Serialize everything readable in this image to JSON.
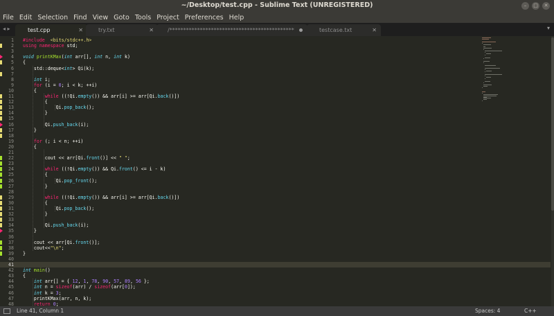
{
  "window": {
    "title": "~/Desktop/test.cpp - Sublime Text (UNREGISTERED)",
    "buttons": [
      "–",
      "□",
      "✕"
    ]
  },
  "menu": [
    "File",
    "Edit",
    "Selection",
    "Find",
    "View",
    "Goto",
    "Tools",
    "Project",
    "Preferences",
    "Help"
  ],
  "tab_nav": "◂ ▸",
  "tabs": [
    {
      "label": "test.cpp",
      "close": "✕",
      "active": true,
      "dirty": false
    },
    {
      "label": "try.txt",
      "close": "✕",
      "active": false,
      "dirty": false
    },
    {
      "label": "/*********************************************",
      "close": "",
      "active": false,
      "dirty": true
    },
    {
      "label": "testcase.txt",
      "close": "✕",
      "active": false,
      "dirty": false
    }
  ],
  "tab_overflow": "▾",
  "editor": {
    "current_line": 41,
    "lines": [
      [
        [
          "t-pre",
          "#include"
        ],
        [
          "",
          "  "
        ],
        [
          "t-str",
          "<bits/stdc++.h>"
        ]
      ],
      [
        [
          "t-kw",
          "using namespace"
        ],
        [
          "",
          " std;"
        ]
      ],
      [],
      [
        [
          "t-ty",
          "void"
        ],
        [
          "",
          " "
        ],
        [
          "t-cls",
          "printKMax"
        ],
        [
          "",
          "("
        ],
        [
          "t-ty",
          "int"
        ],
        [
          "",
          " arr[], "
        ],
        [
          "t-ty",
          "int"
        ],
        [
          "",
          " n, "
        ],
        [
          "t-ty",
          "int"
        ],
        [
          "",
          " k)"
        ]
      ],
      [
        [
          "",
          "{"
        ]
      ],
      [
        [
          "",
          "    std::deque<"
        ],
        [
          "t-ty",
          "int"
        ],
        [
          "",
          "> Qi(k);"
        ]
      ],
      [],
      [
        [
          "",
          "    "
        ],
        [
          "t-ty",
          "int"
        ],
        [
          "",
          " i;"
        ]
      ],
      [
        [
          "",
          "    "
        ],
        [
          "t-kw",
          "for"
        ],
        [
          "",
          " (i = "
        ],
        [
          "t-num",
          "0"
        ],
        [
          "",
          "; i < k; ++i)"
        ]
      ],
      [
        [
          "",
          "    {"
        ]
      ],
      [
        [
          "",
          "        "
        ],
        [
          "t-kw",
          "while"
        ],
        [
          "",
          " ((!Qi."
        ],
        [
          "t-fn",
          "empty"
        ],
        [
          "",
          "()) && arr[i] >= arr[Qi."
        ],
        [
          "t-fn",
          "back"
        ],
        [
          "",
          "()])"
        ]
      ],
      [
        [
          "",
          "        {"
        ]
      ],
      [
        [
          "",
          "            Qi."
        ],
        [
          "t-fn",
          "pop_back"
        ],
        [
          "",
          "();"
        ]
      ],
      [
        [
          "",
          "        }"
        ]
      ],
      [],
      [
        [
          "",
          "        Qi."
        ],
        [
          "t-fn",
          "push_back"
        ],
        [
          "",
          "(i);"
        ]
      ],
      [
        [
          "",
          "    }"
        ]
      ],
      [],
      [
        [
          "",
          "    "
        ],
        [
          "t-kw",
          "for"
        ],
        [
          "",
          " (; i < n; ++i)"
        ]
      ],
      [
        [
          "",
          "    {"
        ]
      ],
      [],
      [
        [
          "",
          "        cout << arr[Qi."
        ],
        [
          "t-fn",
          "front"
        ],
        [
          "",
          "()] << "
        ],
        [
          "t-str",
          "\" \""
        ],
        [
          "",
          ";"
        ]
      ],
      [],
      [
        [
          "",
          "        "
        ],
        [
          "t-kw",
          "while"
        ],
        [
          "",
          " ((!Qi."
        ],
        [
          "t-fn",
          "empty"
        ],
        [
          "",
          "()) && Qi."
        ],
        [
          "t-fn",
          "front"
        ],
        [
          "",
          "() <= i - k)"
        ]
      ],
      [
        [
          "",
          "        {"
        ]
      ],
      [
        [
          "",
          "            Qi."
        ],
        [
          "t-fn",
          "pop_front"
        ],
        [
          "",
          "();"
        ]
      ],
      [
        [
          "",
          "        }"
        ]
      ],
      [],
      [
        [
          "",
          "        "
        ],
        [
          "t-kw",
          "while"
        ],
        [
          "",
          " ((!Qi."
        ],
        [
          "t-fn",
          "empty"
        ],
        [
          "",
          "()) && arr[i] >= arr[Qi."
        ],
        [
          "t-fn",
          "back"
        ],
        [
          "",
          "()])"
        ]
      ],
      [
        [
          "",
          "        {"
        ]
      ],
      [
        [
          "",
          "            Qi."
        ],
        [
          "t-fn",
          "pop_back"
        ],
        [
          "",
          "();"
        ]
      ],
      [
        [
          "",
          "        }"
        ]
      ],
      [],
      [
        [
          "",
          "        Qi."
        ],
        [
          "t-fn",
          "push_back"
        ],
        [
          "",
          "(i);"
        ]
      ],
      [
        [
          "",
          "    }"
        ]
      ],
      [],
      [
        [
          "",
          "    cout << arr[Qi."
        ],
        [
          "t-fn",
          "front"
        ],
        [
          "",
          "()];"
        ]
      ],
      [
        [
          "",
          "    cout<<"
        ],
        [
          "t-str",
          "\"\\n\""
        ],
        [
          "",
          ";"
        ]
      ],
      [
        [
          "",
          "}"
        ]
      ],
      [],
      [],
      [
        [
          "t-ty",
          "int"
        ],
        [
          "",
          " "
        ],
        [
          "t-cls",
          "main"
        ],
        [
          "",
          "()"
        ]
      ],
      [
        [
          "",
          "{"
        ]
      ],
      [
        [
          "",
          "    "
        ],
        [
          "t-ty",
          "int"
        ],
        [
          "",
          " arr[] = { "
        ],
        [
          "t-num",
          "12"
        ],
        [
          "",
          ", "
        ],
        [
          "t-num",
          "1"
        ],
        [
          "",
          ", "
        ],
        [
          "t-num",
          "78"
        ],
        [
          "",
          ", "
        ],
        [
          "t-num",
          "90"
        ],
        [
          "",
          ", "
        ],
        [
          "t-num",
          "57"
        ],
        [
          "",
          ", "
        ],
        [
          "t-num",
          "89"
        ],
        [
          "",
          ", "
        ],
        [
          "t-num",
          "56"
        ],
        [
          "",
          " };"
        ]
      ],
      [
        [
          "",
          "    "
        ],
        [
          "t-ty",
          "int"
        ],
        [
          "",
          " n = "
        ],
        [
          "t-kw",
          "sizeof"
        ],
        [
          "",
          "(arr) / "
        ],
        [
          "t-kw",
          "sizeof"
        ],
        [
          "",
          "(arr["
        ],
        [
          "t-num",
          "0"
        ],
        [
          "",
          "]);"
        ]
      ],
      [
        [
          "",
          "    "
        ],
        [
          "t-ty",
          "int"
        ],
        [
          "",
          " k = "
        ],
        [
          "t-num",
          "3"
        ],
        [
          "",
          ";"
        ]
      ],
      [
        [
          "",
          "    printKMax(arr, n, k);"
        ]
      ],
      [
        [
          "",
          "    "
        ],
        [
          "t-kw",
          "return"
        ],
        [
          "",
          " "
        ],
        [
          "t-num",
          "0"
        ],
        [
          "",
          ";"
        ]
      ],
      [
        [
          "",
          "}"
        ]
      ]
    ],
    "gutter_marks": {
      "2": "mod",
      "4": "del",
      "5": "mod",
      "7": "mod",
      "11": "mod",
      "12": "mod",
      "13": "mod",
      "14": "mod",
      "15": "mod",
      "16": "del",
      "17": "mod",
      "18": "mod",
      "22": "add",
      "23": "add",
      "24": "add",
      "25": "add",
      "26": "add",
      "27": "add",
      "29": "mod",
      "30": "mod",
      "31": "mod",
      "32": "mod",
      "33": "mod",
      "34": "mod",
      "35": "del",
      "37": "add",
      "38": "add",
      "39": "add",
      "49": "del"
    }
  },
  "status": {
    "position": "Line 41, Column 1",
    "spaces": "Spaces: 4",
    "syntax": "C++"
  },
  "colors": {
    "background": "#272822",
    "keyword": "#f92672",
    "type": "#66d9ef",
    "number": "#ae81ff",
    "string": "#e6db74",
    "class_name": "#a6e22e",
    "gutter_modified": "#e6db74",
    "gutter_added": "#a6e22e",
    "gutter_deleted": "#f92672"
  }
}
